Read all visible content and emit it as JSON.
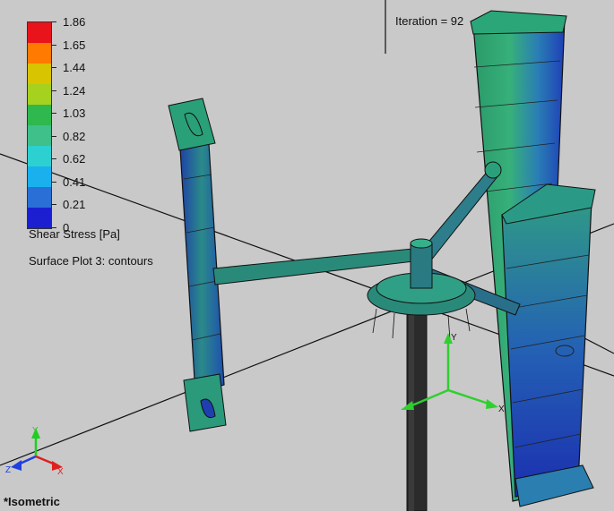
{
  "legend": {
    "ticks": [
      "1.86",
      "1.65",
      "1.44",
      "1.24",
      "1.03",
      "0.82",
      "0.62",
      "0.41",
      "0.21",
      "0"
    ],
    "colors": [
      "#e8131b",
      "#ff7a00",
      "#d8c400",
      "#a7d11f",
      "#2eb84d",
      "#3fbf8a",
      "#2dd0d0",
      "#1ab0ee",
      "#2a6fd6",
      "#1b1fd0"
    ],
    "quantity": "Shear Stress [Pa]",
    "plot": "Surface Plot 3: contours"
  },
  "iteration_label": "Iteration = 92",
  "view_label": "*Isometric",
  "triad": {
    "x": "X",
    "y": "Y",
    "z": "Z"
  }
}
